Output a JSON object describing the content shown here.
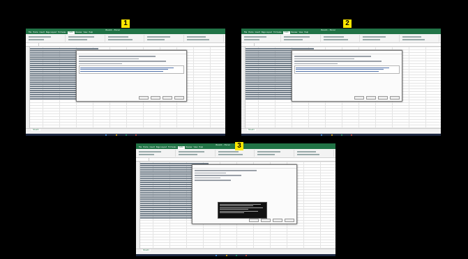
{
  "panels": [
    {
      "badge": "1",
      "title": "Book1 - Excel",
      "tabs": [
        "File",
        "Home",
        "Insert",
        "Page Layout",
        "Formulas",
        "Data",
        "Review",
        "View",
        "Help"
      ],
      "active_tab": "Data",
      "sheet_tab": "Sheet1"
    },
    {
      "badge": "2",
      "title": "Book1 - Excel",
      "tabs": [
        "File",
        "Home",
        "Insert",
        "Page Layout",
        "Formulas",
        "Data",
        "Review",
        "View",
        "Help"
      ],
      "active_tab": "Data",
      "sheet_tab": "Sheet1"
    },
    {
      "badge": "3",
      "title": "Book1 - Excel",
      "tabs": [
        "File",
        "Home",
        "Insert",
        "Page Layout",
        "Formulas",
        "Data",
        "Review",
        "View",
        "Help"
      ],
      "active_tab": "Data",
      "sheet_tab": "Sheet1"
    }
  ],
  "colors": {
    "background": "#000000",
    "badge": "#ffe800",
    "excel_green": "#217346",
    "taskbar": "#1f2a44"
  }
}
